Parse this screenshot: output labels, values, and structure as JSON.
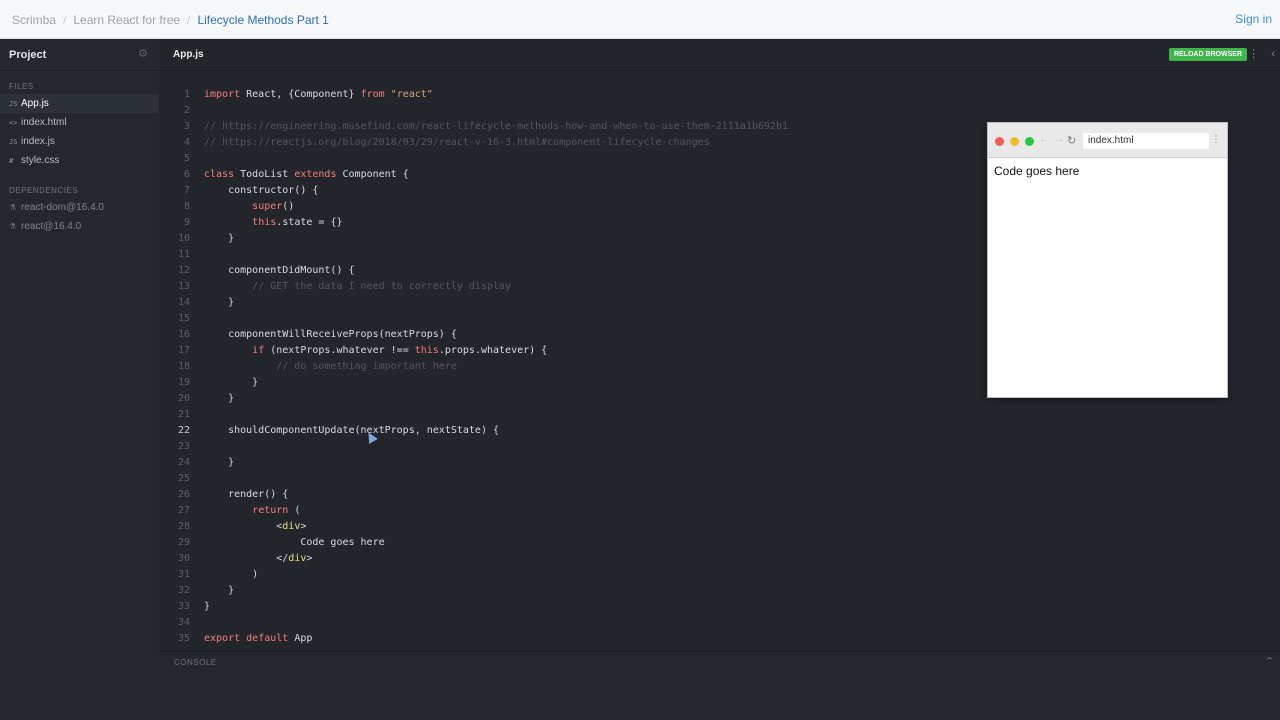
{
  "breadcrumbs": [
    {
      "label": "Scrimba"
    },
    {
      "label": "Learn React for free"
    },
    {
      "label": "Lifecycle Methods Part 1"
    }
  ],
  "signin_label": "Sign in",
  "sidebar": {
    "title": "Project",
    "files_label": "FILES",
    "files": [
      {
        "icon": "JS",
        "label": "App.js"
      },
      {
        "icon": "<>",
        "label": "index.html"
      },
      {
        "icon": "JS",
        "label": "index.js"
      },
      {
        "icon": "#",
        "label": "style.css"
      }
    ],
    "deps_label": "DEPENDENCIES",
    "deps": [
      {
        "label": "react-dom@16.4.0"
      },
      {
        "label": "react@16.4.0"
      }
    ]
  },
  "editor": {
    "tab_label": "App.js",
    "reload_label": "RELOAD BROWSER",
    "current_line": 22,
    "lines": [
      [
        {
          "t": "import",
          "c": "kw"
        },
        {
          "t": " React, {Component} "
        },
        {
          "t": "from",
          "c": "kw"
        },
        {
          "t": " "
        },
        {
          "t": "\"react\"",
          "c": "str"
        }
      ],
      [],
      [
        {
          "t": "// https://engineering.musefind.com/react-lifecycle-methods-how-and-when-to-use-them-2111a1b692b1",
          "c": "cmt"
        }
      ],
      [
        {
          "t": "// https://reactjs.org/blog/2018/03/29/react-v-16-3.html#component-lifecycle-changes",
          "c": "cmt"
        }
      ],
      [],
      [
        {
          "t": "class",
          "c": "kw"
        },
        {
          "t": " TodoList "
        },
        {
          "t": "extends",
          "c": "kw"
        },
        {
          "t": " Component {"
        }
      ],
      [
        {
          "t": "    constructor() {"
        }
      ],
      [
        {
          "t": "        "
        },
        {
          "t": "super",
          "c": "kw"
        },
        {
          "t": "()"
        }
      ],
      [
        {
          "t": "        "
        },
        {
          "t": "this",
          "c": "kw"
        },
        {
          "t": ".state = {}"
        }
      ],
      [
        {
          "t": "    }"
        }
      ],
      [],
      [
        {
          "t": "    componentDidMount() {"
        }
      ],
      [
        {
          "t": "        "
        },
        {
          "t": "// GET the data I need to correctly display",
          "c": "cmt"
        }
      ],
      [
        {
          "t": "    }"
        }
      ],
      [],
      [
        {
          "t": "    componentWillReceiveProps(nextProps) {"
        }
      ],
      [
        {
          "t": "        "
        },
        {
          "t": "if",
          "c": "kw"
        },
        {
          "t": " (nextProps.whatever !== "
        },
        {
          "t": "this",
          "c": "kw"
        },
        {
          "t": ".props.whatever) {"
        }
      ],
      [
        {
          "t": "            "
        },
        {
          "t": "// do something important here",
          "c": "cmt"
        }
      ],
      [
        {
          "t": "        }"
        }
      ],
      [
        {
          "t": "    }"
        }
      ],
      [],
      [
        {
          "t": "    shouldComponentUpdate(nextProps, nextState) {"
        }
      ],
      [],
      [
        {
          "t": "    }"
        }
      ],
      [],
      [
        {
          "t": "    render() {"
        }
      ],
      [
        {
          "t": "        "
        },
        {
          "t": "return",
          "c": "kw"
        },
        {
          "t": " ("
        }
      ],
      [
        {
          "t": "            <"
        },
        {
          "t": "div",
          "c": "tag"
        },
        {
          "t": ">"
        }
      ],
      [
        {
          "t": "                Code goes here"
        }
      ],
      [
        {
          "t": "            </"
        },
        {
          "t": "div",
          "c": "tag"
        },
        {
          "t": ">"
        }
      ],
      [
        {
          "t": "        )"
        }
      ],
      [
        {
          "t": "    }"
        }
      ],
      [
        {
          "t": "}"
        }
      ],
      [],
      [
        {
          "t": "export",
          "c": "kw"
        },
        {
          "t": " "
        },
        {
          "t": "default",
          "c": "kw"
        },
        {
          "t": " App"
        }
      ]
    ]
  },
  "console_label": "CONSOLE",
  "preview": {
    "url": "index.html",
    "content": "Code goes here"
  },
  "icons": {
    "gear": "gear-icon",
    "kebab": "kebab-menu-icon",
    "collapse": "chevron-left-icon",
    "console_toggle": "chevron-up-icon"
  }
}
